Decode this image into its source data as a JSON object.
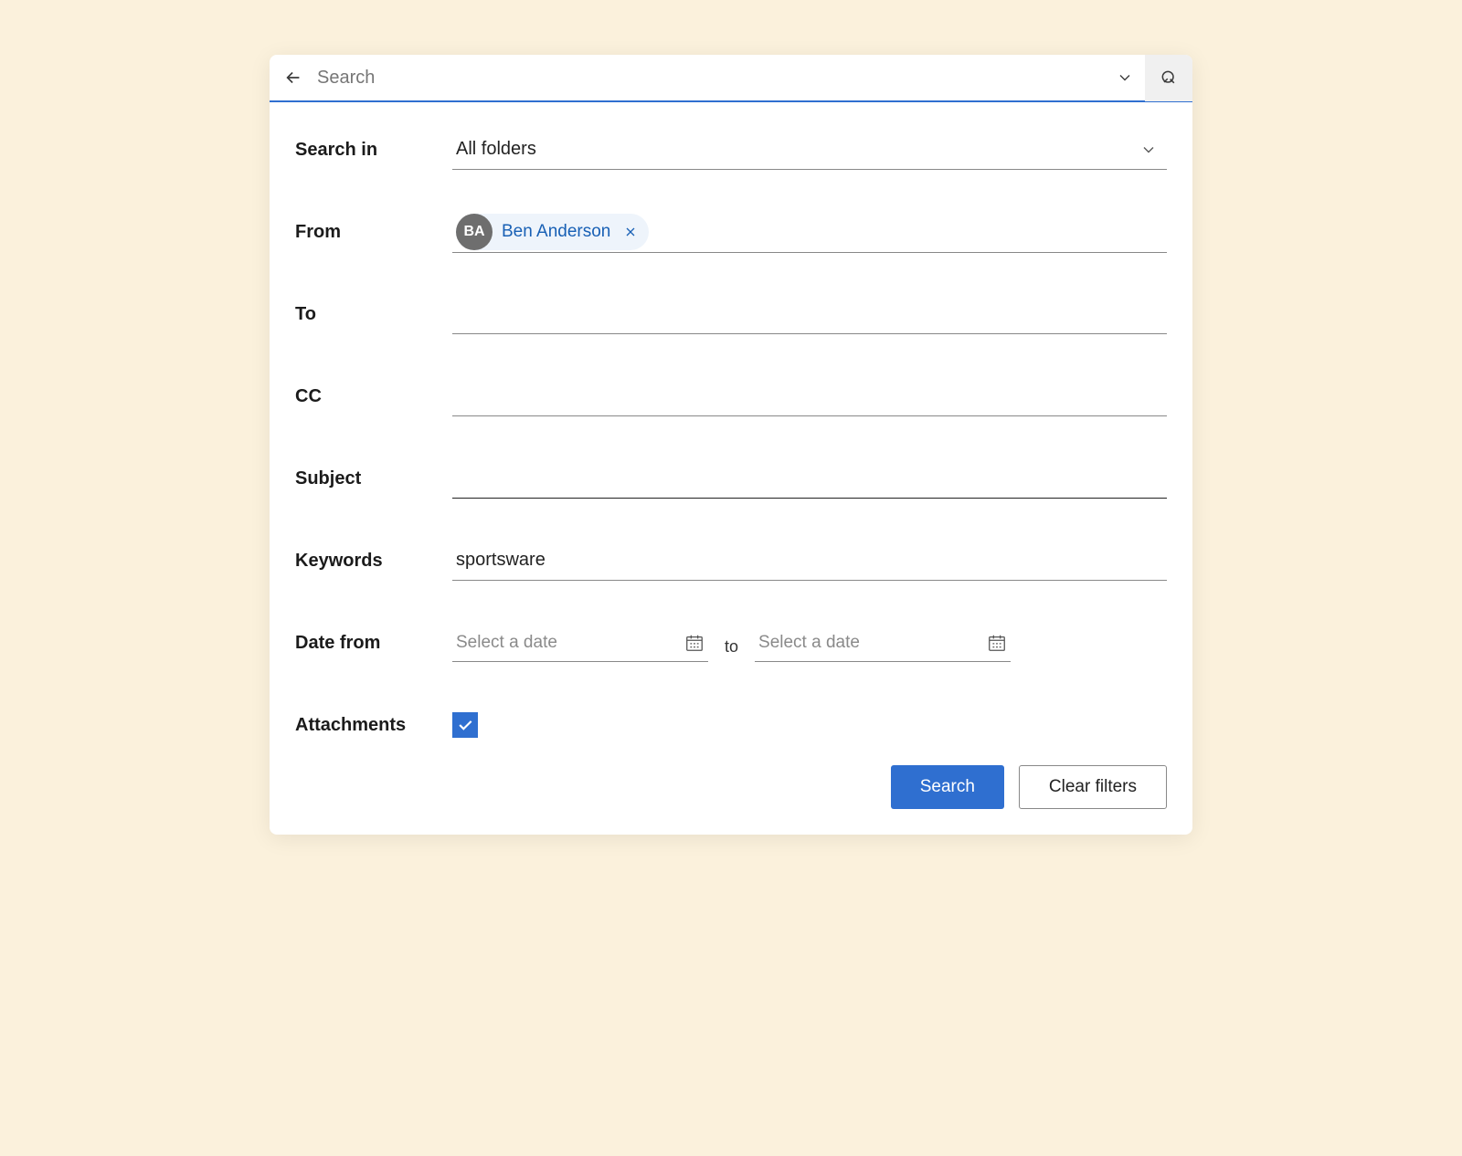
{
  "searchbar": {
    "placeholder": "Search"
  },
  "labels": {
    "search_in": "Search in",
    "from": "From",
    "to": "To",
    "cc": "CC",
    "subject": "Subject",
    "keywords": "Keywords",
    "date_from": "Date from",
    "date_to_sep": "to",
    "attachments": "Attachments"
  },
  "fields": {
    "search_in_value": "All folders",
    "from_chip": {
      "initials": "BA",
      "name": "Ben Anderson"
    },
    "to_value": "",
    "cc_value": "",
    "subject_value": "",
    "keywords_value": "sportsware",
    "date_from_placeholder": "Select a date",
    "date_to_placeholder": "Select a date",
    "attachments_checked": true
  },
  "buttons": {
    "search": "Search",
    "clear": "Clear filters"
  }
}
